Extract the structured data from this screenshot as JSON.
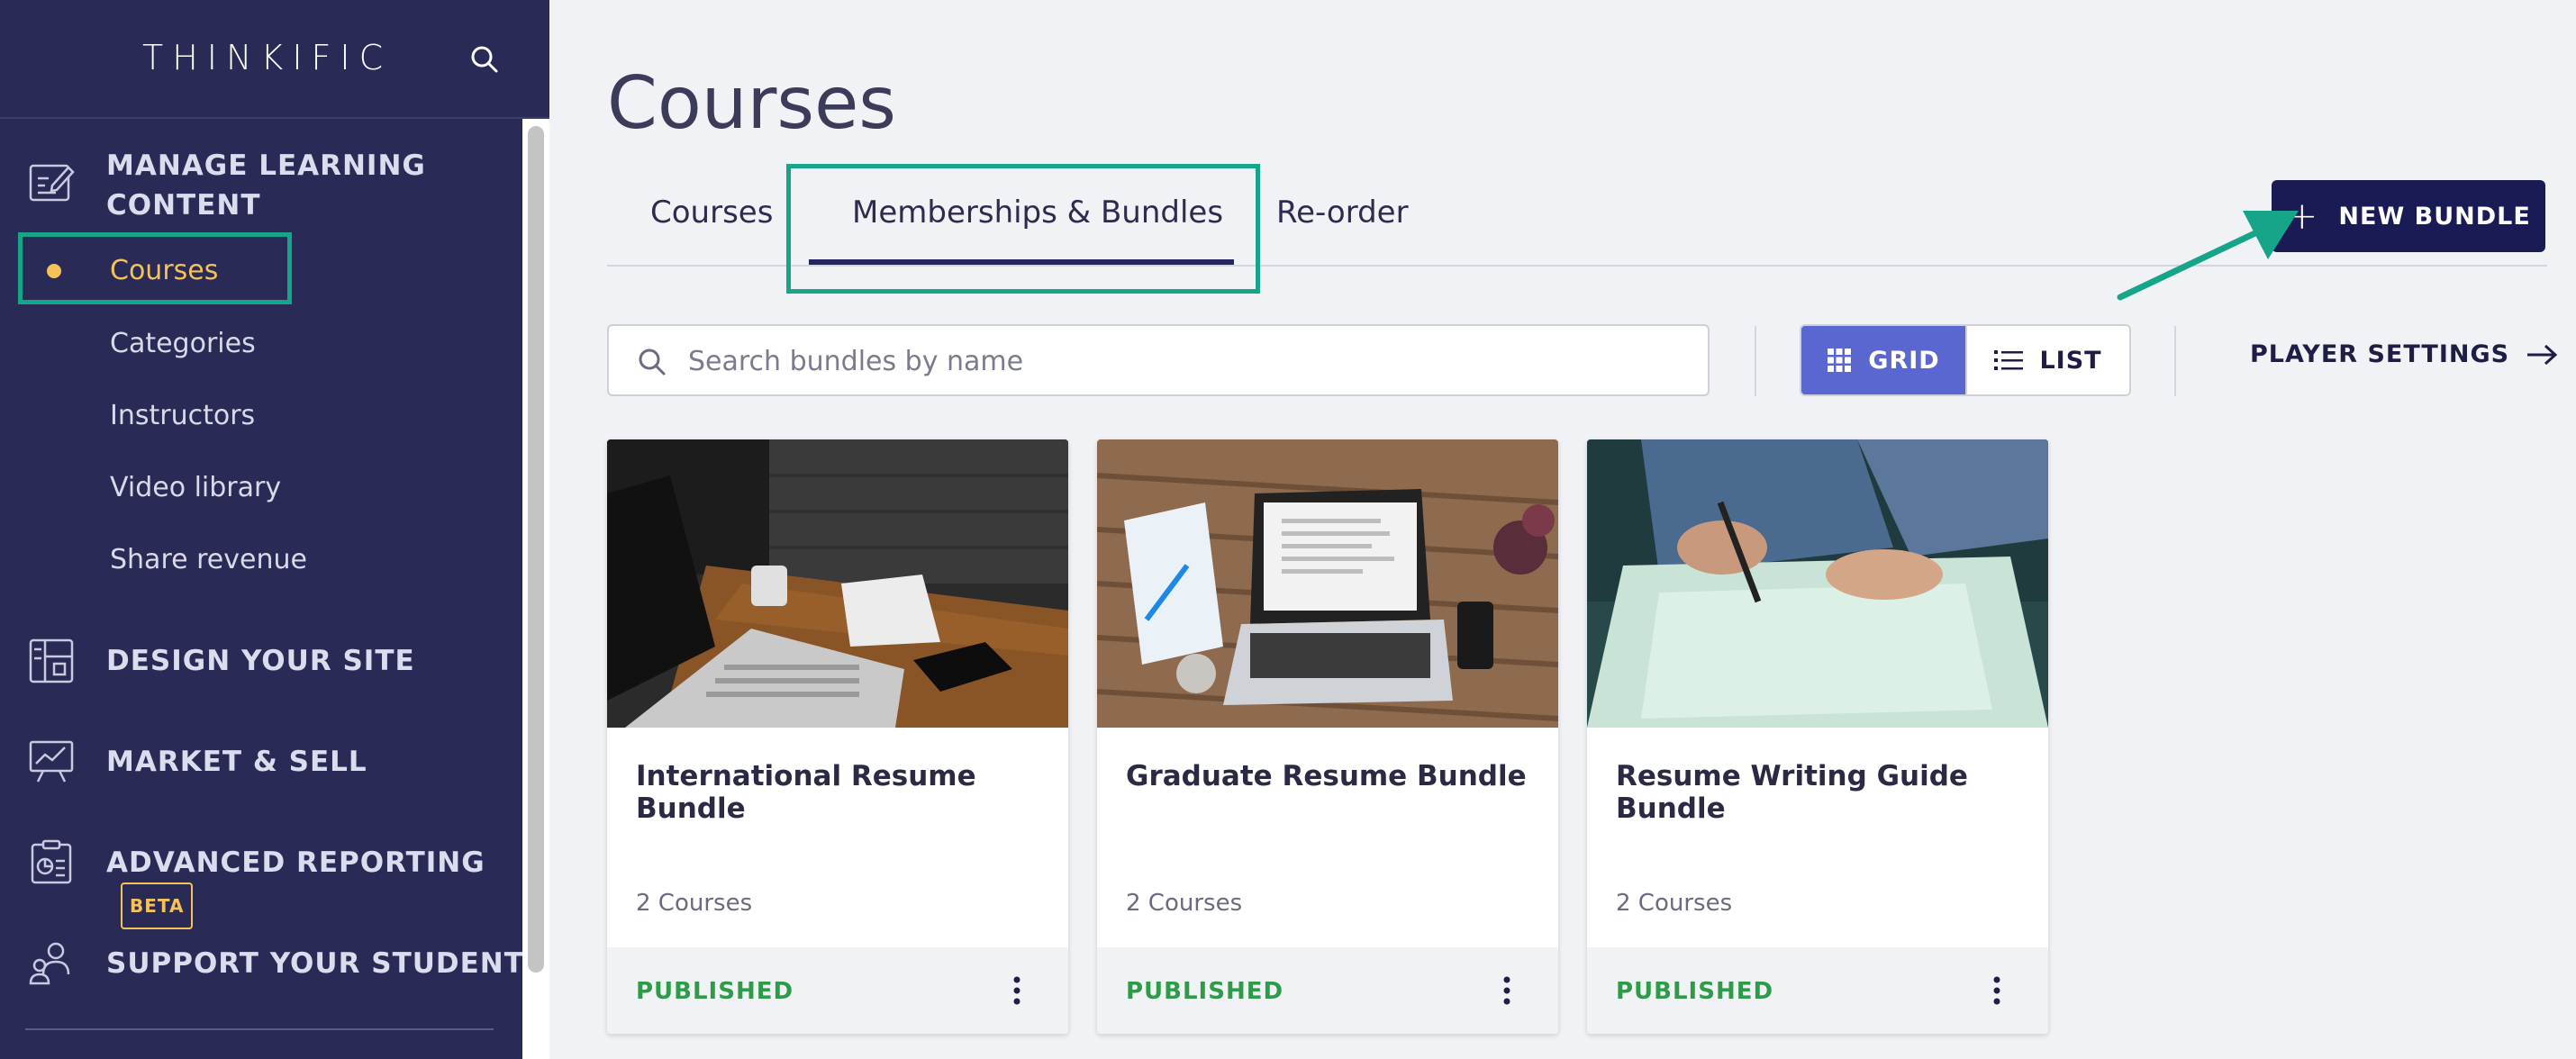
{
  "brand": {
    "name": "THINKIFIC"
  },
  "sidebar": {
    "sections": [
      {
        "title_line1": "MANAGE LEARNING",
        "title_line2": "CONTENT",
        "icon": "edit-content-icon"
      },
      {
        "title": "DESIGN YOUR SITE",
        "icon": "layout-icon"
      },
      {
        "title": "MARKET & SELL",
        "icon": "chart-board-icon"
      },
      {
        "title": "ADVANCED REPORTING",
        "badge": "BETA",
        "icon": "report-icon"
      },
      {
        "title": "SUPPORT YOUR STUDENTS",
        "icon": "users-icon"
      }
    ],
    "sub_items": [
      "Courses",
      "Categories",
      "Instructors",
      "Video library",
      "Share revenue"
    ],
    "active_sub_item": "Courses"
  },
  "page": {
    "title": "Courses"
  },
  "tabs": [
    {
      "label": "Courses",
      "active": false
    },
    {
      "label": "Memberships & Bundles",
      "active": true
    },
    {
      "label": "Re-order",
      "active": false
    }
  ],
  "actions": {
    "new_bundle": "NEW BUNDLE",
    "player_settings": "PLAYER SETTINGS"
  },
  "search": {
    "placeholder": "Search bundles by name",
    "value": ""
  },
  "view_toggle": {
    "grid": "GRID",
    "list": "LIST",
    "selected": "GRID"
  },
  "cards": [
    {
      "title": "International Resume Bundle",
      "count": "2 Courses",
      "status": "PUBLISHED"
    },
    {
      "title": "Graduate Resume Bundle",
      "count": "2 Courses",
      "status": "PUBLISHED"
    },
    {
      "title": "Resume Writing Guide Bundle",
      "count": "2 Courses",
      "status": "PUBLISHED"
    }
  ],
  "colors": {
    "sidebar_bg": "#2a2a57",
    "accent_yellow": "#f5c25a",
    "highlight_teal": "#17a589",
    "primary_button": "#1a1a55",
    "grid_toggle": "#5b67d1",
    "published_green": "#2e9b48"
  }
}
